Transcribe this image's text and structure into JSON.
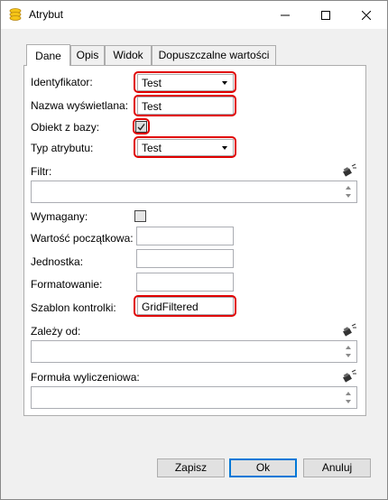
{
  "window": {
    "title": "Atrybut",
    "app_icon": "coins-icon",
    "controls": [
      "minimize-icon",
      "maximize-icon",
      "close-icon"
    ]
  },
  "tabs": [
    {
      "label": "Dane",
      "active": true
    },
    {
      "label": "Opis",
      "active": false
    },
    {
      "label": "Widok",
      "active": false
    },
    {
      "label": "Dopuszczalne wartości",
      "active": false
    }
  ],
  "form": {
    "identyfikator": {
      "label": "Identyfikator:",
      "value": "Test"
    },
    "nazwa": {
      "label": "Nazwa wyświetlana:",
      "value": "Test"
    },
    "obiekt": {
      "label": "Obiekt z bazy:",
      "checked": true
    },
    "typ": {
      "label": "Typ atrybutu:",
      "value": "Test"
    },
    "filtr": {
      "label": "Filtr:",
      "value": ""
    },
    "wymagany": {
      "label": "Wymagany:",
      "checked": false
    },
    "wartosc": {
      "label": "Wartość początkowa:",
      "value": ""
    },
    "jednostka": {
      "label": "Jednostka:",
      "value": ""
    },
    "formatowanie": {
      "label": "Formatowanie:",
      "value": ""
    },
    "szablon": {
      "label": "Szablon kontrolki:",
      "value": "GridFiltered"
    },
    "zalezy": {
      "label": "Zależy od:",
      "value": ""
    },
    "formula": {
      "label": "Formuła wyliczeniowa:",
      "value": ""
    }
  },
  "buttons": {
    "save": "Zapisz",
    "ok": "Ok",
    "cancel": "Anuluj"
  },
  "colors": {
    "highlight": "#e00000",
    "default_button_border": "#0078d7"
  }
}
